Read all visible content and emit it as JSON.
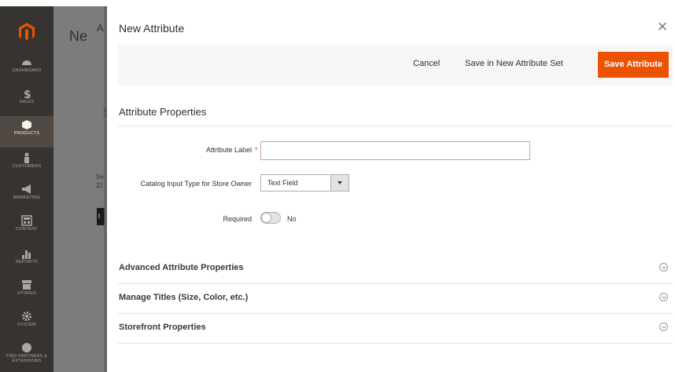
{
  "sidebar": {
    "items": [
      {
        "label": "Dashboard",
        "icon": "dashboard-icon"
      },
      {
        "label": "Sales",
        "icon": "dollar-icon"
      },
      {
        "label": "Products",
        "icon": "cube-icon"
      },
      {
        "label": "Customers",
        "icon": "person-icon"
      },
      {
        "label": "Marketing",
        "icon": "megaphone-icon"
      },
      {
        "label": "Content",
        "icon": "layout-icon"
      },
      {
        "label": "Reports",
        "icon": "bar-chart-icon"
      },
      {
        "label": "Stores",
        "icon": "store-icon"
      },
      {
        "label": "System",
        "icon": "gear-icon"
      },
      {
        "label": "Find Partners & Extensions",
        "icon": "partners-icon"
      }
    ],
    "active_index": 2
  },
  "background_page": {
    "title": "Ne",
    "title2": "A",
    "section_letter": "S",
    "small_text_line1": "Se",
    "small_text_line2": "22",
    "button_letter": "t"
  },
  "modal": {
    "title": "New Attribute",
    "close": "×",
    "toolbar": {
      "cancel": "Cancel",
      "save_in_set": "Save in New Attribute Set",
      "save": "Save Attribute"
    },
    "section_title": "Attribute Properties",
    "fields": {
      "attribute_label": {
        "label": "Attribute Label",
        "required_mark": "*",
        "value": ""
      },
      "input_type": {
        "label": "Catalog Input Type for Store Owner",
        "value": "Text Field"
      },
      "required": {
        "label": "Required",
        "value": "No"
      }
    },
    "collapsibles": [
      "Advanced Attribute Properties",
      "Manage Titles (Size, Color, etc.)",
      "Storefront Properties"
    ]
  },
  "colors": {
    "accent": "#eb5202",
    "sidebar_bg": "#373330",
    "sidebar_active": "#514943"
  }
}
